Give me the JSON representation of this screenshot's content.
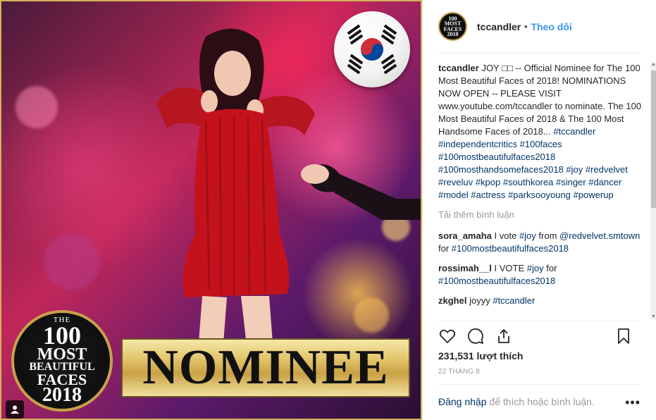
{
  "photo": {
    "banner_text": "NOMINEE",
    "medal": {
      "the": "THE",
      "num": "100",
      "most": "MOST",
      "beautiful": "BEAUTIFUL",
      "faces": "FACES",
      "year": "2018"
    }
  },
  "header": {
    "username": "tccandler",
    "separator": "•",
    "follow_label": "Theo dõi",
    "avatar_text": "100 MOST FACES 2018"
  },
  "caption": {
    "username": "tccandler",
    "text_before": "JOY □□ -- Official Nominee for The 100 Most Beautiful Faces of 2018! NOMINATIONS NOW OPEN -- PLEASE VISIT www.youtube.com/tccandler to nominate. The 100 Most Beautiful Faces of 2018 & The 100 Most Handsome Faces of 2018...",
    "hashtags": [
      "#tccandler",
      "#independentcritics",
      "#100faces",
      "#100mostbeautifulfaces2018",
      "#100mosthandsomefaces2018",
      "#joy",
      "#redvelvet",
      "#reveluv",
      "#kpop",
      "#southkorea",
      "#singer",
      "#dancer",
      "#model",
      "#actress",
      "#parksooyoung",
      "#powerup"
    ]
  },
  "load_more": "Tải thêm bình luận",
  "comments": [
    {
      "user": "sora_amaha",
      "pre": "I vote",
      "tag1": "#joy",
      "mid": "from",
      "mention": "@redvelvet.smtown",
      "post": "for",
      "tag2": "#100mostbeautifulfaces2018"
    },
    {
      "user": "rossimah__l",
      "pre": "I VOTE",
      "tag1": "#joy",
      "mid": "for",
      "tag2": "#100mostbeautifulfaces2018"
    },
    {
      "user": "zkghel",
      "pre": "joyyy",
      "tag1": "#tccandler"
    }
  ],
  "likes_text": "231,531 lượt thích",
  "date_text": "22 THÁNG 8",
  "login": {
    "link": "Đăng nhập",
    "rest": "để thích hoặc bình luận."
  },
  "more_options": "•••"
}
